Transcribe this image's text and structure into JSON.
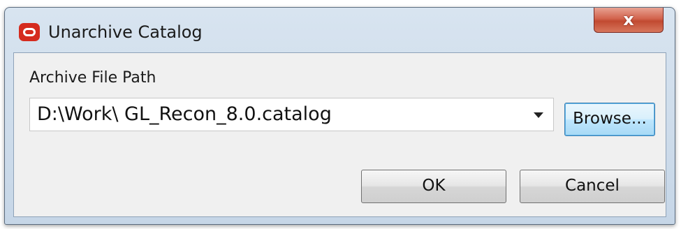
{
  "window": {
    "title": "Unarchive Catalog",
    "close_label": "x"
  },
  "archive_path": {
    "label": "Archive File Path",
    "value": "D:\\Work\\ GL_Recon_8.0.catalog"
  },
  "buttons": {
    "browse": "Browse...",
    "ok": "OK",
    "cancel": "Cancel"
  },
  "icons": {
    "app": "oracle-logo-icon",
    "dropdown": "chevron-down-icon",
    "close": "close-icon"
  },
  "colors": {
    "app_icon": "#d52b1e",
    "close_button": "#c14a31",
    "focus_button": "#a7d9f5"
  }
}
